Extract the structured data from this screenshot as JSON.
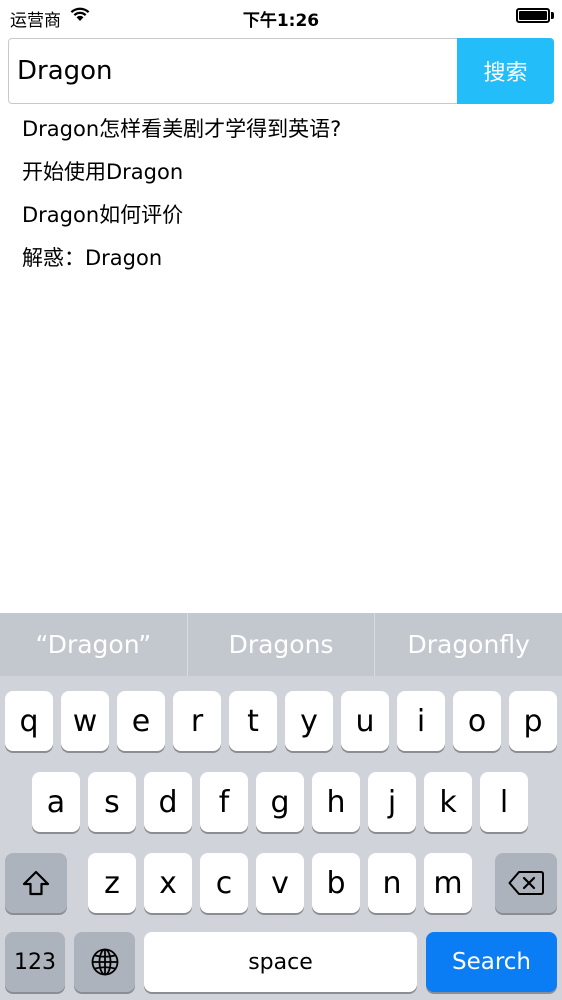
{
  "status_bar": {
    "carrier": "运营商",
    "time": "下午1:26",
    "battery_level": 1.0
  },
  "search": {
    "value": "Dragon",
    "button_label": "搜索"
  },
  "suggestions": [
    "Dragon怎样看美剧才学得到英语?",
    "开始使用Dragon",
    "Dragon如何评价",
    "解惑：Dragon"
  ],
  "keyboard": {
    "predictions": [
      "“Dragon”",
      "Dragons",
      "Dragonfly"
    ],
    "row1": [
      "q",
      "w",
      "e",
      "r",
      "t",
      "y",
      "u",
      "i",
      "o",
      "p"
    ],
    "row2": [
      "a",
      "s",
      "d",
      "f",
      "g",
      "h",
      "j",
      "k",
      "l"
    ],
    "row3": [
      "z",
      "x",
      "c",
      "v",
      "b",
      "n",
      "m"
    ],
    "numbers_label": "123",
    "space_label": "space",
    "return_label": "Search"
  },
  "colors": {
    "search_button": "#23bdf9",
    "return_key": "#0a7cf4",
    "keyboard_bg": "#d0d3d9"
  }
}
